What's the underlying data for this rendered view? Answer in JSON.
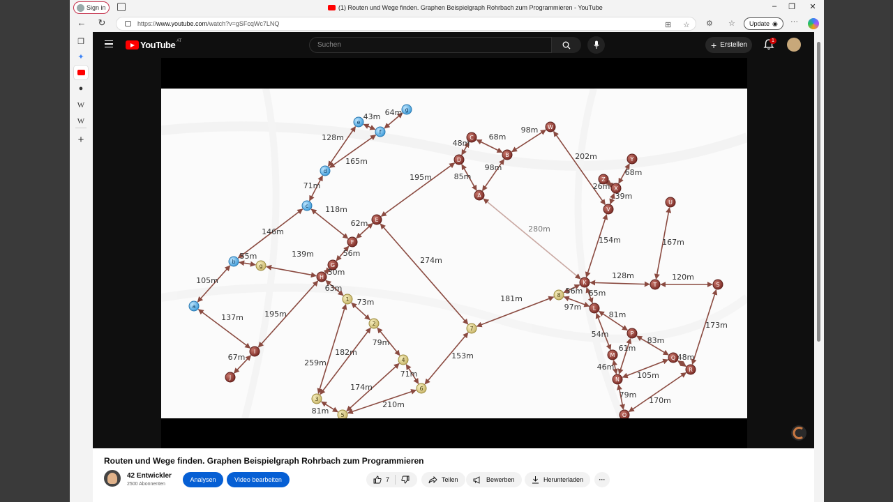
{
  "browser": {
    "signin_label": "Sign in",
    "tab_title": "(1) Routen und Wege finden. Graphen Beispielgraph Rohrbach zum Programmieren - YouTube",
    "url_prefix": "https://",
    "url_host": "www.youtube.com",
    "url_path": "/watch?v=gSFcqWc7LNQ",
    "update_label": "Update",
    "window_buttons": [
      "–",
      "❐",
      "✕"
    ]
  },
  "sidebar": {
    "items": [
      "tabs-icon",
      "copilot-icon",
      "youtube-icon",
      "github-icon",
      "wikipedia-icon",
      "wikipedia-icon",
      "add-icon"
    ],
    "labels": [
      "W",
      "W"
    ]
  },
  "youtube": {
    "logo_text": "YouTube",
    "logo_country": "AT",
    "search_placeholder": "Suchen",
    "create_label": "Erstellen",
    "notification_count": "1"
  },
  "video": {
    "title": "Routen und Wege finden. Graphen Beispielgraph Rohrbach zum Programmieren",
    "channel_name": "42 Entwickler",
    "channel_subs": "2500 Abonnenten",
    "analytics_label": "Analysen",
    "edit_label": "Video bearbeiten",
    "like_count": "7",
    "share_label": "Teilen",
    "promote_label": "Bewerben",
    "download_label": "Herunterladen",
    "more_label": "···"
  },
  "graph": {
    "nodes": [
      {
        "id": "a",
        "color": "blue"
      },
      {
        "id": "b",
        "color": "blue"
      },
      {
        "id": "c",
        "color": "blue"
      },
      {
        "id": "d",
        "color": "blue"
      },
      {
        "id": "e",
        "color": "blue"
      },
      {
        "id": "f",
        "color": "blue"
      },
      {
        "id": "g",
        "color": "blue"
      },
      {
        "id": "g2",
        "label": "g",
        "color": "yellow"
      },
      {
        "id": "1",
        "color": "yellow"
      },
      {
        "id": "2",
        "color": "yellow"
      },
      {
        "id": "3",
        "color": "yellow"
      },
      {
        "id": "4",
        "color": "yellow"
      },
      {
        "id": "5",
        "color": "yellow"
      },
      {
        "id": "6",
        "color": "yellow"
      },
      {
        "id": "7",
        "color": "yellow"
      },
      {
        "id": "8",
        "color": "yellow"
      },
      {
        "id": "A",
        "color": "brown"
      },
      {
        "id": "B",
        "color": "brown"
      },
      {
        "id": "C",
        "color": "brown"
      },
      {
        "id": "D",
        "color": "brown"
      },
      {
        "id": "E",
        "color": "brown"
      },
      {
        "id": "F",
        "color": "brown"
      },
      {
        "id": "G",
        "color": "brown"
      },
      {
        "id": "H",
        "color": "brown"
      },
      {
        "id": "I",
        "color": "brown"
      },
      {
        "id": "J",
        "color": "brown"
      },
      {
        "id": "K",
        "color": "brown"
      },
      {
        "id": "L",
        "color": "brown"
      },
      {
        "id": "M",
        "color": "brown"
      },
      {
        "id": "N",
        "color": "brown"
      },
      {
        "id": "O",
        "color": "brown"
      },
      {
        "id": "P",
        "color": "brown"
      },
      {
        "id": "Q",
        "color": "brown"
      },
      {
        "id": "R",
        "color": "brown"
      },
      {
        "id": "S",
        "color": "brown"
      },
      {
        "id": "T",
        "color": "brown"
      },
      {
        "id": "U",
        "color": "brown"
      },
      {
        "id": "V",
        "color": "brown"
      },
      {
        "id": "W",
        "color": "brown"
      },
      {
        "id": "X",
        "color": "brown"
      },
      {
        "id": "Y",
        "color": "brown"
      },
      {
        "id": "Z",
        "color": "brown"
      }
    ],
    "edges": [
      {
        "from": "a",
        "to": "b",
        "label": "105m"
      },
      {
        "from": "b",
        "to": "g2",
        "label": "55m"
      },
      {
        "from": "b",
        "to": "c",
        "label": "146m"
      },
      {
        "from": "c",
        "to": "d",
        "label": "71m"
      },
      {
        "from": "d",
        "to": "e",
        "label": "128m"
      },
      {
        "from": "d",
        "to": "f",
        "label": "165m"
      },
      {
        "from": "e",
        "to": "f",
        "label": "43m"
      },
      {
        "from": "f",
        "to": "g",
        "label": "64m"
      },
      {
        "from": "c",
        "to": "F",
        "label": "118m"
      },
      {
        "from": "a",
        "to": "I",
        "label": "137m"
      },
      {
        "from": "I",
        "to": "J",
        "label": "67m"
      },
      {
        "from": "I",
        "to": "H",
        "label": "195m"
      },
      {
        "from": "g2",
        "to": "H",
        "label": "139m"
      },
      {
        "from": "H",
        "to": "G",
        "label": "30m"
      },
      {
        "from": "G",
        "to": "F",
        "label": "56m"
      },
      {
        "from": "F",
        "to": "E",
        "label": "62m"
      },
      {
        "from": "E",
        "to": "D",
        "label": "195m"
      },
      {
        "from": "E",
        "to": "7",
        "label": "274m"
      },
      {
        "from": "D",
        "to": "C",
        "label": "48m"
      },
      {
        "from": "D",
        "to": "A",
        "label": "85m"
      },
      {
        "from": "C",
        "to": "B",
        "label": "68m"
      },
      {
        "from": "B",
        "to": "A",
        "label": "98m"
      },
      {
        "from": "B",
        "to": "W",
        "label": "98m"
      },
      {
        "from": "W",
        "to": "V",
        "label": "202m"
      },
      {
        "from": "A",
        "to": "K",
        "label": "280m"
      },
      {
        "from": "H",
        "to": "1",
        "label": "63m"
      },
      {
        "from": "1",
        "to": "2",
        "label": "73m"
      },
      {
        "from": "1",
        "to": "3",
        "label": "259m"
      },
      {
        "from": "2",
        "to": "3",
        "label": "182m"
      },
      {
        "from": "2",
        "to": "4",
        "label": "79m"
      },
      {
        "from": "4",
        "to": "5",
        "label": "174m"
      },
      {
        "from": "4",
        "to": "6",
        "label": "71m"
      },
      {
        "from": "3",
        "to": "5",
        "label": "81m"
      },
      {
        "from": "5",
        "to": "6",
        "label": "210m"
      },
      {
        "from": "6",
        "to": "7",
        "label": "153m"
      },
      {
        "from": "7",
        "to": "8",
        "label": "181m"
      },
      {
        "from": "8",
        "to": "K",
        "label": "56m"
      },
      {
        "from": "8",
        "to": "L",
        "label": "97m"
      },
      {
        "from": "K",
        "to": "L",
        "label": "65m"
      },
      {
        "from": "K",
        "to": "V",
        "label": "154m"
      },
      {
        "from": "K",
        "to": "T",
        "label": "128m"
      },
      {
        "from": "T",
        "to": "S",
        "label": "120m"
      },
      {
        "from": "T",
        "to": "U",
        "label": "167m"
      },
      {
        "from": "V",
        "to": "X",
        "label": "39m"
      },
      {
        "from": "X",
        "to": "Z",
        "label": "26m"
      },
      {
        "from": "X",
        "to": "Y",
        "label": "68m"
      },
      {
        "from": "L",
        "to": "P",
        "label": "81m"
      },
      {
        "from": "L",
        "to": "M",
        "label": "54m"
      },
      {
        "from": "P",
        "to": "N",
        "label": "61m"
      },
      {
        "from": "P",
        "to": "Q",
        "label": "83m"
      },
      {
        "from": "M",
        "to": "N",
        "label": "46m"
      },
      {
        "from": "N",
        "to": "Q",
        "label": "105m"
      },
      {
        "from": "Q",
        "to": "R",
        "label": "48m"
      },
      {
        "from": "R",
        "to": "S",
        "label": "173m"
      },
      {
        "from": "N",
        "to": "O",
        "label": "79m"
      },
      {
        "from": "O",
        "to": "R",
        "label": "170m"
      }
    ]
  }
}
